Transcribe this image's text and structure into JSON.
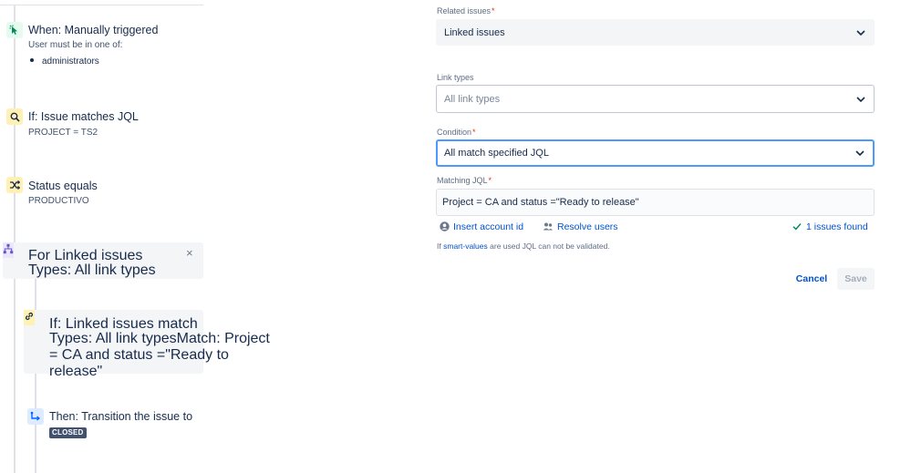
{
  "flow": {
    "trigger": {
      "title": "When: Manually triggered",
      "subtitle": "User must be in one of:",
      "groups": [
        "administrators"
      ]
    },
    "condition_jql": {
      "title": "If: Issue matches JQL",
      "subtitle": "PROJECT = TS2"
    },
    "condition_status": {
      "title": "Status equals",
      "subtitle": "PRODUCTIVO"
    },
    "branch": {
      "title": "For Linked issues",
      "subtitle": "Types: All link types",
      "close_glyph": "×"
    },
    "linked_condition": {
      "title": "If: Linked issues match",
      "subtitle_lines": [
        "Types: All link typesMatch: Project",
        "= CA and status =\"Ready to",
        "release\""
      ]
    },
    "action": {
      "title": "Then: Transition the issue to",
      "status_lozenge": "CLOSED"
    }
  },
  "form": {
    "related_issues": {
      "label": "Related issues",
      "required_mark": "*",
      "value": "Linked issues"
    },
    "link_types": {
      "label": "Link types",
      "placeholder": "All link types"
    },
    "condition": {
      "label": "Condition",
      "required_mark": "*",
      "value": "All match specified JQL"
    },
    "matching_jql": {
      "label": "Matching JQL",
      "required_mark": "*",
      "value": "Project = CA and status =\"Ready to release\""
    },
    "insert_account_id": "Insert account id",
    "resolve_users": "Resolve users",
    "issues_found": "1 issues found",
    "note_prefix": "If",
    "note_link": "smart-values",
    "note_suffix": "are used JQL can not be validated.",
    "cancel_label": "Cancel",
    "save_label": "Save"
  },
  "colors": {
    "accent": "#0052cc",
    "focus_border": "#4c9aff",
    "required": "#de350b",
    "trigger_icon": "#00875a",
    "condition_icon": "#ff991f",
    "branch_icon": "#6554c0",
    "action_icon": "#0065ff"
  },
  "icons": {
    "trigger": "cursor-click-icon",
    "condition_jql": "search-icon",
    "condition_status": "shuffle-icon",
    "branch": "hierarchy-icon",
    "linked_condition": "link-icon",
    "action": "transition-arrow-icon",
    "chevron": "chevron-down-icon",
    "person": "person-icon",
    "people": "people-icon",
    "check": "check-icon"
  }
}
